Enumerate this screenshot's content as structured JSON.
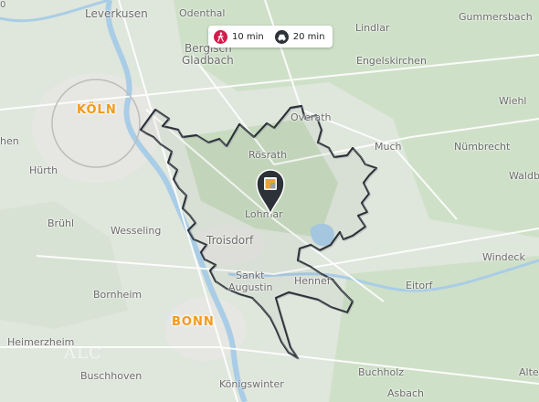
{
  "legend": {
    "walk": {
      "icon": "walking-person-icon",
      "label": "10 min",
      "color": "#d21c4b"
    },
    "drive": {
      "icon": "car-icon",
      "label": "20 min",
      "color": "#2d3238"
    }
  },
  "places": {
    "leverkusen": "Leverkusen",
    "odenthal": "Odenthal",
    "lindlar": "Lindlar",
    "gummersbach": "Gummersbach",
    "bergisch": "Bergisch",
    "gladbach": "Gladbach",
    "engelskirchen": "Engelskirchen",
    "koeln": "KÖLN",
    "overath": "Overath",
    "wiehl": "Wiehl",
    "much": "Much",
    "nuembrecht": "Nümbrecht",
    "hen": "hen",
    "huerth": "Hürth",
    "roesrath": "Rösrath",
    "waldbroel": "Waldbr",
    "lohmar": "Lohmar",
    "bruehl": "Brühl",
    "wesseling": "Wesseling",
    "troisdorf": "Troisdorf",
    "windeck": "Windeck",
    "sankt": "Sankt",
    "augustin": "Augustin",
    "hennef": "Hennef",
    "bornheim": "Bornheim",
    "eitorf": "Eitorf",
    "bonn": "BONN",
    "heimerzheim": "Heimerzheim",
    "buchholz": "Buchholz",
    "alte": "Alte",
    "buschhoven": "Buschhoven",
    "koenigswinter": "Königswinter",
    "asbach": "Asbach",
    "corner_zero": "0"
  },
  "watermark": "ALC",
  "colors": {
    "land": "#dfe6dc",
    "forest": "#c9dcc2",
    "river": "#a9cde6",
    "isochrone": "#2d3238",
    "accent": "#f29a1a"
  },
  "marker": {
    "icon": "location-pin-icon"
  }
}
